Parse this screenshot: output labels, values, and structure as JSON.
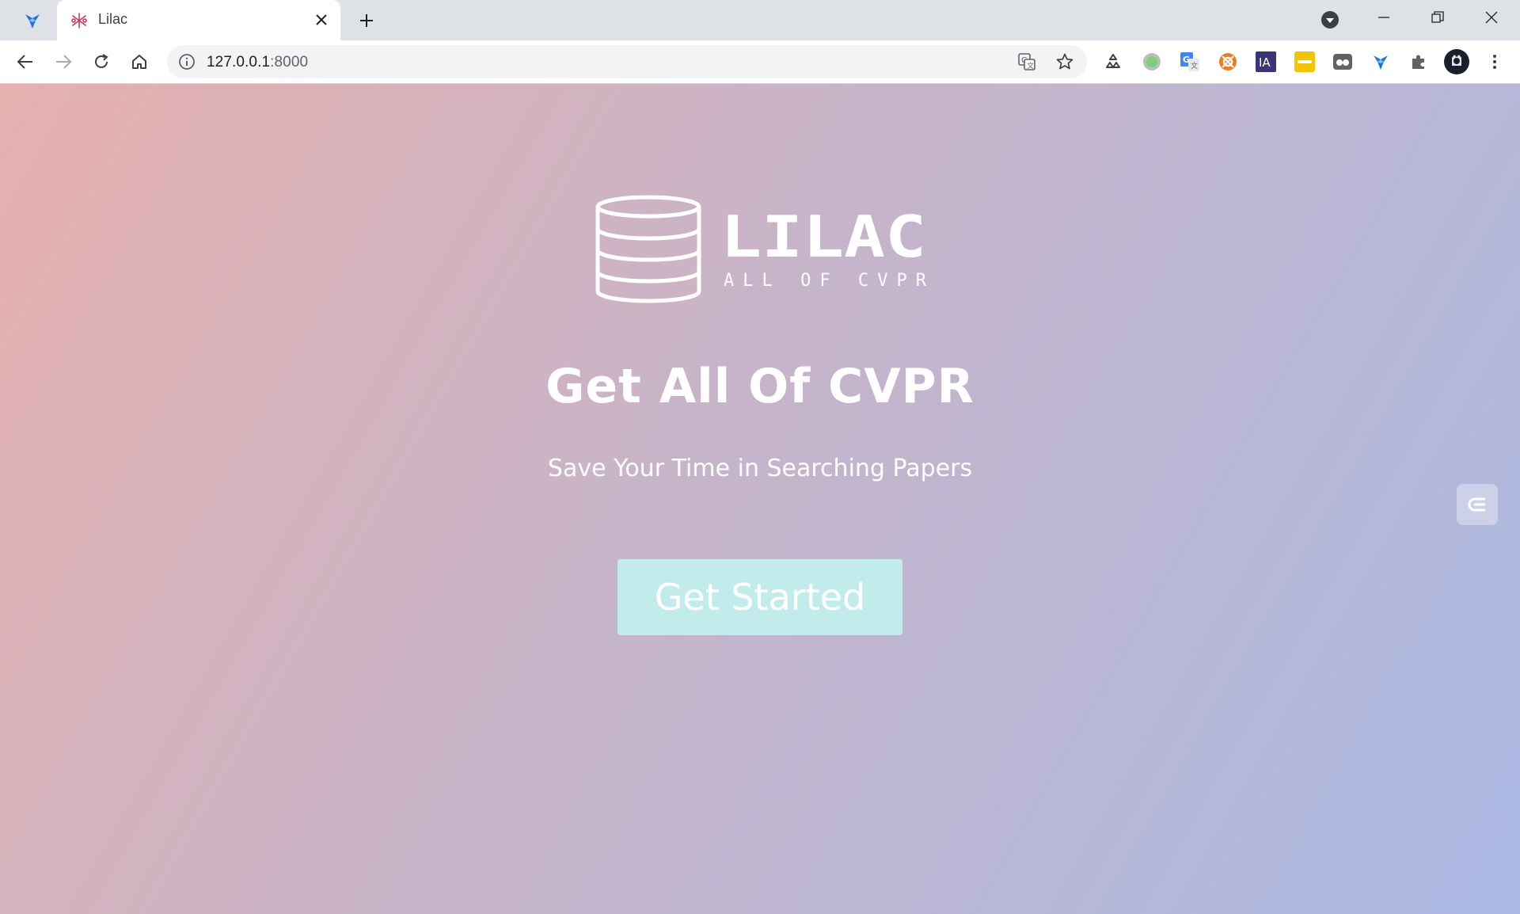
{
  "browser": {
    "tab": {
      "title": "Lilac",
      "close_icon": "close-icon"
    },
    "omnibox": {
      "host": "127.0.0.1",
      "port": ":8000"
    },
    "extensions": [
      "recycle-extension-icon",
      "green-circle-extension-icon",
      "google-translate-extension-icon",
      "orange-extension-icon",
      "ia-extension-icon",
      "yellow-password-extension-icon",
      "tab-manager-extension-icon",
      "blue-bird-extension-icon",
      "puzzle-icon"
    ],
    "ia_label": "IA"
  },
  "page": {
    "logo": {
      "title": "LILAC",
      "tagline": "ALL OF CVPR"
    },
    "headline": "Get All Of CVPR",
    "subheadline": "Save Your Time in Searching Papers",
    "cta_label": "Get Started"
  },
  "colors": {
    "gradient_start": "#e6b0ae",
    "gradient_end": "#aab9e3",
    "cta_background": "#c2ecec",
    "text": "#ffffff"
  }
}
